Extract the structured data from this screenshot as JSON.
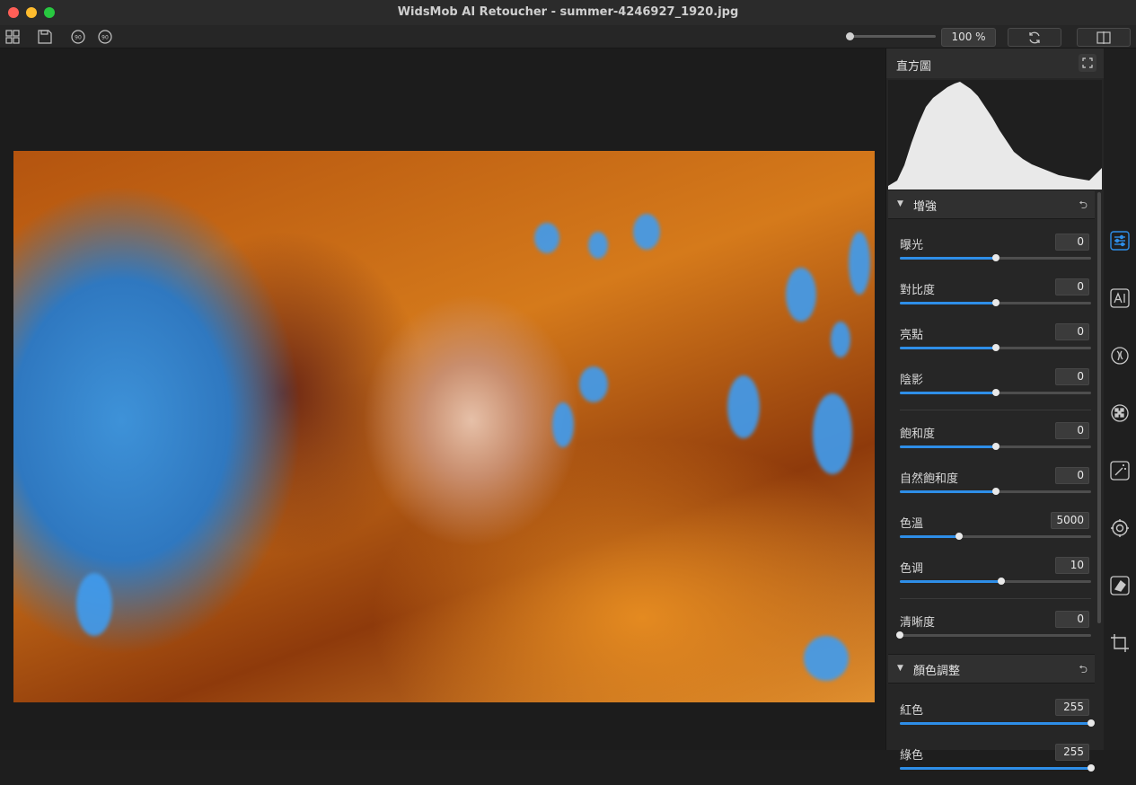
{
  "window": {
    "title": "WidsMob AI Retoucher - summer-4246927_1920.jpg"
  },
  "toolbar": {
    "icons": [
      "grid-icon",
      "save-icon",
      "rotate-left-90-icon",
      "rotate-right-90-icon"
    ],
    "rotate_left_label": "90",
    "rotate_right_label": "90",
    "zoom_value": "100 %",
    "zoom_slider_fraction": 0.0,
    "buttons": [
      "refresh-icon",
      "compare-split-icon"
    ]
  },
  "panel": {
    "histogram": {
      "title": "直方圖"
    },
    "enhance": {
      "title": "增強",
      "rows": [
        {
          "label": "曝光",
          "value": "0",
          "fraction": 0.5
        },
        {
          "label": "對比度",
          "value": "0",
          "fraction": 0.5
        },
        {
          "label": "亮點",
          "value": "0",
          "fraction": 0.5
        },
        {
          "label": "陰影",
          "value": "0",
          "fraction": 0.5
        },
        {
          "label": "飽和度",
          "value": "0",
          "fraction": 0.5
        },
        {
          "label": "自然飽和度",
          "value": "0",
          "fraction": 0.5
        },
        {
          "label": "色溫",
          "value": "5000",
          "fraction": 0.31
        },
        {
          "label": "色调",
          "value": "10",
          "fraction": 0.53
        },
        {
          "label": "清晰度",
          "value": "0",
          "fraction": 0.0
        }
      ]
    },
    "color_adjust": {
      "title": "顏色調整",
      "rows": [
        {
          "label": "紅色",
          "value": "255",
          "fraction": 1.0
        },
        {
          "label": "綠色",
          "value": "255",
          "fraction": 1.0
        }
      ]
    }
  },
  "tool_strip": [
    "adjust-sliders-icon",
    "ai-icon",
    "face-retouch-icon",
    "noise-pattern-icon",
    "magic-wand-icon",
    "settings-gear-icon",
    "eraser-icon",
    "crop-icon"
  ],
  "colors": {
    "accent": "#2e8ee8",
    "background": "#1e1e1e",
    "panel": "#262626"
  }
}
